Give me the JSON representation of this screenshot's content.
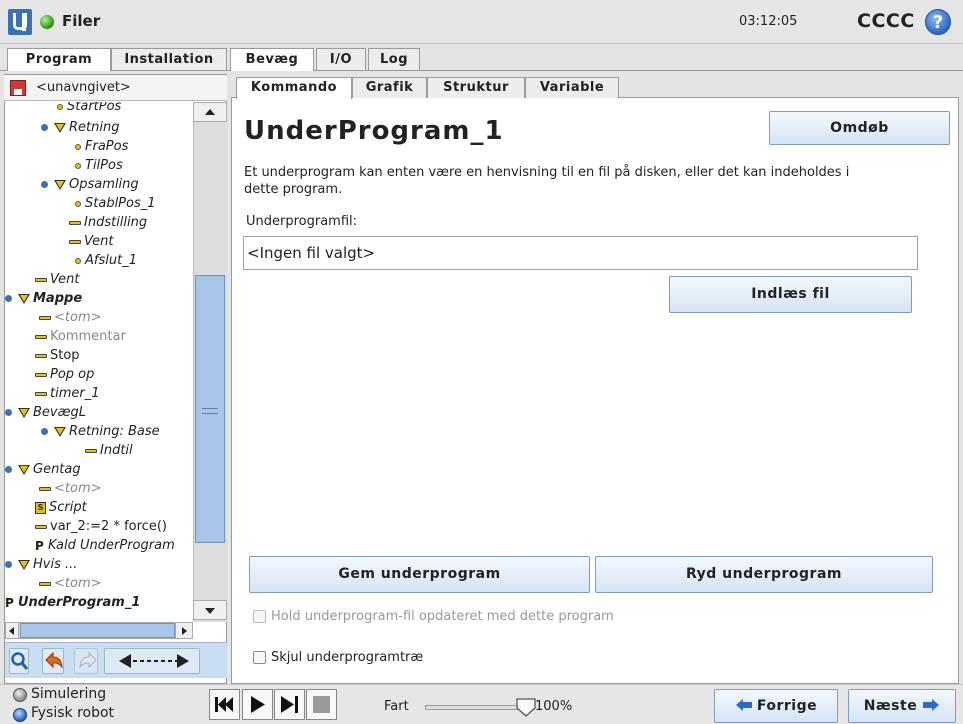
{
  "header": {
    "app_title": "Filer",
    "clock": "03:12:05",
    "robot_name": "CCCC",
    "help_label": "?"
  },
  "main_tabs": {
    "program": "Program",
    "installation": "Installation",
    "move": "Bevæg",
    "io": "I/O",
    "log": "Log"
  },
  "left_panel": {
    "file_name": "<unavngivet>",
    "tree": [
      {
        "label": "StartPos"
      },
      {
        "label": "Retning"
      },
      {
        "label": "FraPos"
      },
      {
        "label": "TilPos"
      },
      {
        "label": "Opsamling"
      },
      {
        "label": "StablPos_1"
      },
      {
        "label": "Indstilling"
      },
      {
        "label": "Vent"
      },
      {
        "label": "Afslut_1"
      },
      {
        "label": "Vent"
      },
      {
        "label": "Mappe"
      },
      {
        "label": "<tom>"
      },
      {
        "label": "Kommentar"
      },
      {
        "label": "Stop"
      },
      {
        "label": "Pop op"
      },
      {
        "label": "timer_1"
      },
      {
        "label": "BevægL"
      },
      {
        "label": "Retning: Base"
      },
      {
        "label": "Indtil"
      },
      {
        "label": "Gentag"
      },
      {
        "label": "<tom>"
      },
      {
        "label": "Script"
      },
      {
        "label": "var_2:=2 * force()"
      },
      {
        "label": "Kald UnderProgram"
      },
      {
        "label": "Hvis ..."
      },
      {
        "label": "<tom>"
      },
      {
        "label": "UnderProgram_1"
      }
    ]
  },
  "sub_tabs": {
    "command": "Kommando",
    "graphics": "Grafik",
    "structure": "Struktur",
    "variables": "Variable"
  },
  "command": {
    "heading": "UnderProgram_1",
    "rename_label": "Omdøb",
    "description": "Et underprogram kan enten være en henvisning til en fil på disken, eller det kan indeholdes i dette program.",
    "file_label": "Underprogramfil:",
    "file_value": "<Ingen fil valgt>",
    "load_label": "Indlæs fil",
    "save_label": "Gem underprogram",
    "clear_label": "Ryd underprogram",
    "keep_updated_label": "Hold underprogram-fil opdateret med dette program",
    "keep_updated_checked": false,
    "hide_tree_label": "Skjul underprogramtræ",
    "hide_tree_checked": false
  },
  "footer": {
    "simulation_label": "Simulering",
    "real_robot_label": "Fysisk robot",
    "speed_label": "Fart",
    "speed_value": "100%",
    "speed_fraction": 1.0,
    "prev_label": "Forrige",
    "next_label": "Næste"
  },
  "colors": {
    "accent": "#3a72b8",
    "button_border": "#7f9bbf",
    "selection": "#a9c6e8",
    "node_yellow": "#e8c30a"
  }
}
